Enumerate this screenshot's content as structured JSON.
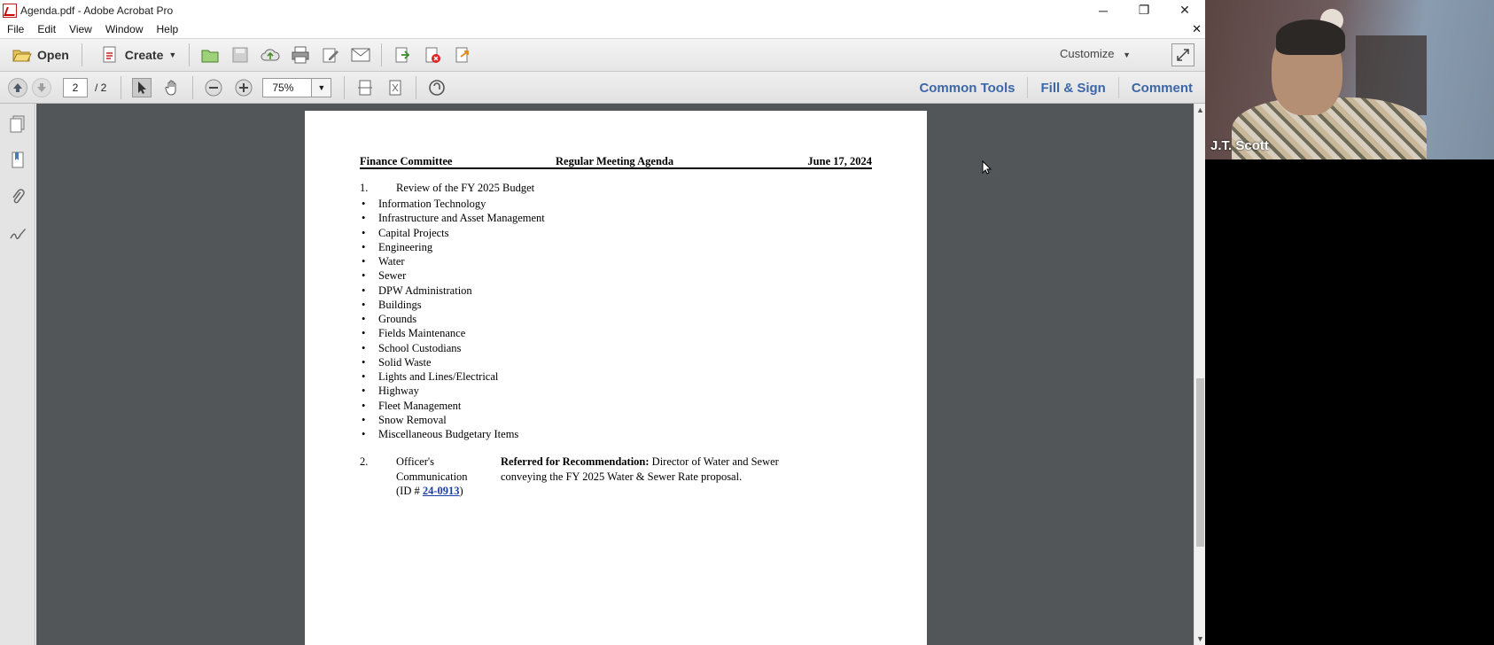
{
  "window": {
    "title": "Agenda.pdf - Adobe Acrobat Pro",
    "controls": [
      "─",
      "❐",
      "✕"
    ]
  },
  "menu": [
    "File",
    "Edit",
    "View",
    "Window",
    "Help"
  ],
  "menu_close": "✕",
  "toolbar": {
    "open_label": "Open",
    "create_label": "Create",
    "customize_label": "Customize"
  },
  "nav": {
    "current_page": "2",
    "total_pages": "/ 2",
    "zoom": "75%"
  },
  "panels": {
    "common_tools": "Common Tools",
    "fill_sign": "Fill & Sign",
    "comment": "Comment"
  },
  "document": {
    "header_left": "Finance Committee",
    "header_center": "Regular Meeting Agenda",
    "header_right": "June 17, 2024",
    "item1_num": "1.",
    "item1_title": "Review of the FY 2025 Budget",
    "item1_bullets": [
      "Information Technology",
      "Infrastructure and Asset Management",
      "Capital Projects",
      "Engineering",
      "Water",
      "Sewer",
      "DPW Administration",
      "Buildings",
      "Grounds",
      "Fields Maintenance",
      "School Custodians",
      "Solid Waste",
      "Lights and Lines/Electrical",
      "Highway",
      "Fleet Management",
      "Snow Removal",
      "Miscellaneous Budgetary Items"
    ],
    "item2_num": "2.",
    "item2_type_line1": "Officer's",
    "item2_type_line2": "Communication",
    "item2_id_prefix": "(ID # ",
    "item2_id": "24-0913",
    "item2_id_suffix": ")",
    "item2_bold": "Referred for Recommendation:",
    "item2_text": " Director of Water and Sewer conveying the FY 2025 Water & Sewer Rate proposal."
  },
  "video": {
    "participant_name": "J.T. Scott"
  }
}
